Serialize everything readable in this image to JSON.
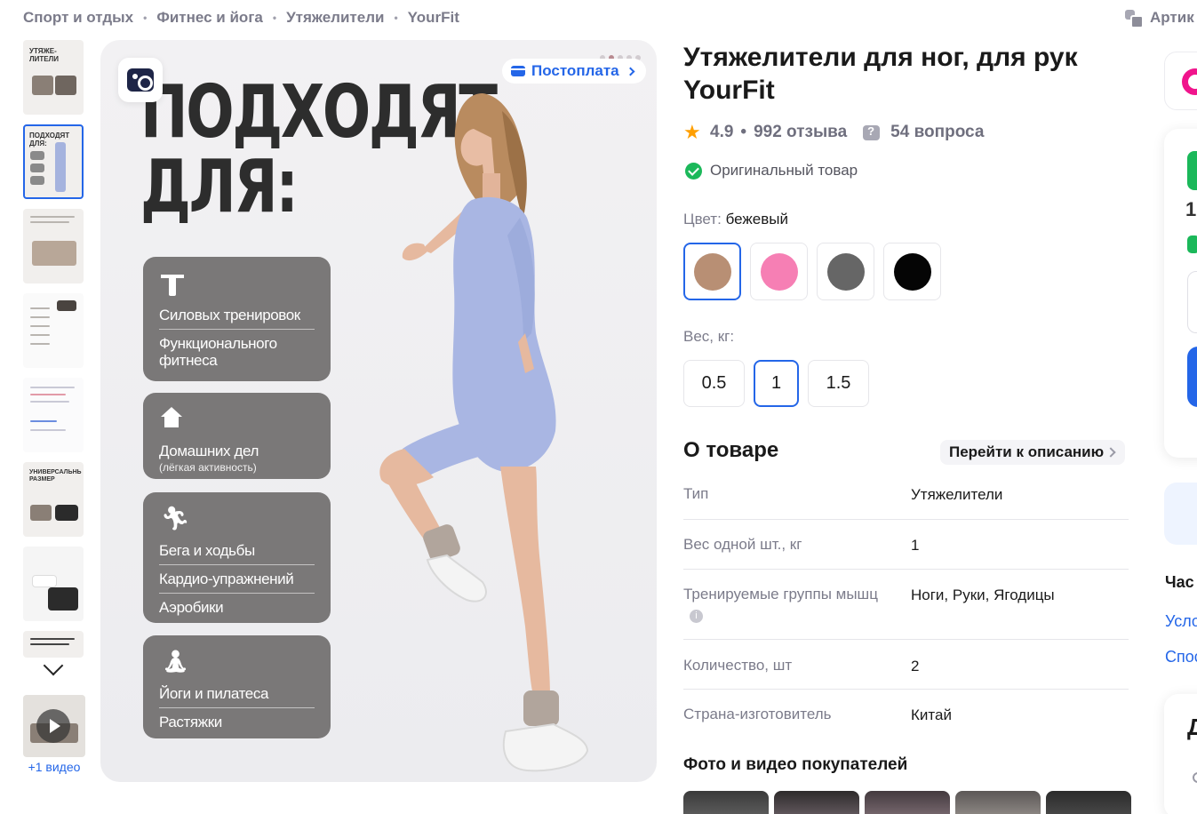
{
  "breadcrumb": [
    "Спорт и отдых",
    "Фитнес и йога",
    "Утяжелители",
    "YourFit"
  ],
  "breadcrumb_sep": "•",
  "header": {
    "article_label": "Артик"
  },
  "gallery": {
    "thumbs": [
      {
        "title": "УТЯЖЕ-ЛИТЕЛИ"
      },
      {
        "title": "ПОДХОДЯТ ДЛЯ:"
      },
      {
        "title": ""
      },
      {
        "title": ""
      },
      {
        "title": ""
      },
      {
        "title": "УНИВЕРСАЛЬНЫЙ РАЗМЕР"
      },
      {
        "title": ""
      },
      {
        "title": ""
      }
    ],
    "video_label": "+1 видео",
    "postpay_label": "Постоплата",
    "headline_line1": "ПОДХОДЯТ",
    "headline_line2": "ДЛЯ:",
    "cards": [
      {
        "items": [
          "Силовых тренировок",
          "Функционального фитнеса"
        ]
      },
      {
        "items": [
          "Домашних дел"
        ],
        "sub": "(лёгкая активность)"
      },
      {
        "items": [
          "Бега и ходьбы",
          "Кардио-упражнений",
          "Аэробики"
        ]
      },
      {
        "items": [
          "Йоги и пилатеса",
          "Растяжки"
        ]
      }
    ]
  },
  "product": {
    "title": "Утяжелители для ног, для рук YourFit",
    "rating": "4.9",
    "reviews": "992 отзыва",
    "questions": "54 вопроса",
    "original": "Оригинальный товар",
    "color_label": "Цвет:",
    "color_value": "бежевый",
    "colors": [
      "#b88f74",
      "#f67fb4",
      "#666666",
      "#050505"
    ],
    "weight_label": "Вес, кг:",
    "weights": [
      "0.5",
      "1",
      "1.5"
    ],
    "about_title": "О товаре",
    "goto_description": "Перейти к описанию",
    "specs": [
      {
        "k": "Тип",
        "v": "Утяжелители"
      },
      {
        "k": "Вес одной шт., кг",
        "v": "1"
      },
      {
        "k": "Тренируемые группы мышц",
        "v": "Ноги, Руки, Ягодицы"
      },
      {
        "k": "Количество, шт",
        "v": "2"
      },
      {
        "k": "Страна-изготовитель",
        "v": "Китай"
      }
    ],
    "photos_title": "Фото и видео покупателей"
  },
  "side": {
    "number": "1",
    "heading": "Час",
    "link1": "Усло",
    "link2": "Спос",
    "card_letter": "Д"
  },
  "colors": {
    "accent": "#2466e8",
    "success": "#1bb85a",
    "star": "#ff9f00",
    "brand": "#f0148c"
  }
}
